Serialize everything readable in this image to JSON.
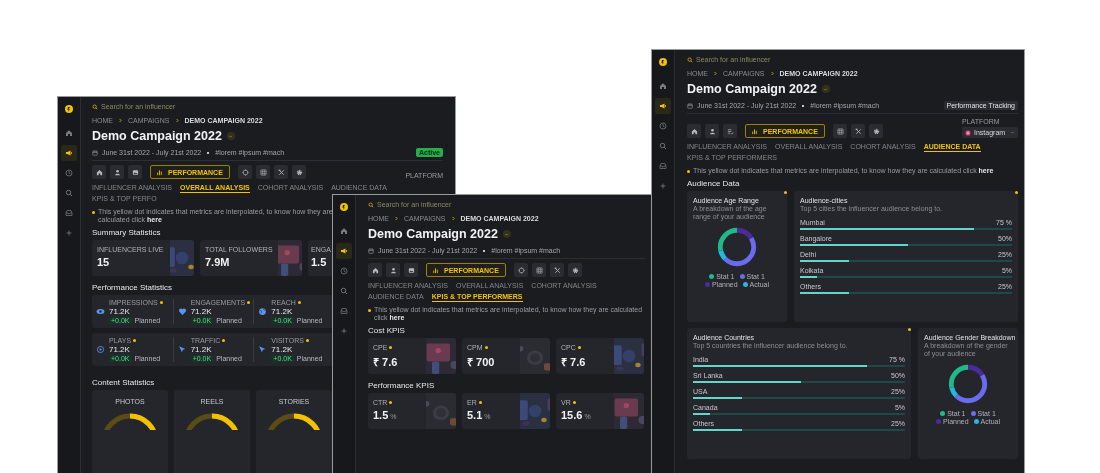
{
  "windows": [
    {
      "kind": "overall",
      "sidebar_items": [
        {
          "selected": false
        },
        {
          "selected": true
        },
        {
          "selected": false
        },
        {
          "selected": false
        },
        {
          "selected": false
        },
        {
          "selected": false
        }
      ],
      "search": {
        "placeholder": "Search for an influencer"
      },
      "breadcrumb": [
        "HOME",
        "CAMPAIGNS",
        "DEMO CAMPAIGN 2022"
      ],
      "title": "Demo Campaign 2022",
      "dates": "June 31st 2022 - July 21st 2022",
      "tags": "#lorem #ipsum #mach",
      "status": "Active",
      "view_button": "PERFORMANCE",
      "platform": {
        "label": "PLATFORM"
      },
      "tabs": [
        {
          "label": "INFLUENCER ANALYSIS",
          "selected": false
        },
        {
          "label": "OVERALL ANALYSIS",
          "selected": true
        },
        {
          "label": "COHORT ANALYSIS",
          "selected": false
        },
        {
          "label": "AUDIENCE DATA",
          "selected": false
        },
        {
          "label": "KPIS & TOP PERFO",
          "selected": false
        }
      ],
      "note": {
        "text": "This yellow dot indicates that metrics are interpolated, to know how they are calculated click",
        "link": "here"
      },
      "sections": [
        {
          "kind": "stat_cards",
          "title": "Summary Statistics",
          "cards": [
            {
              "label": "INFLUENCERS LIVE",
              "value": "15"
            },
            {
              "label": "TOTAL FOLLOWERS",
              "value": "7.9M"
            },
            {
              "label": "ENGA",
              "value": "1.5"
            }
          ]
        },
        {
          "kind": "metric_panels",
          "title": "Performance Statistics",
          "rows": [
            [
              {
                "label": "IMPRESSIONS",
                "dot": true,
                "value": "71.2K",
                "change": "+0.0K",
                "note": "Planned"
              },
              {
                "label": "ENGAGEMENTS",
                "dot": true,
                "value": "71.2K",
                "change": "+0.0K",
                "note": "Planned"
              },
              {
                "label": "REACH",
                "dot": true,
                "value": "71.2K",
                "change": "+0.0K",
                "note": "Planned"
              }
            ],
            [
              {
                "label": "PLAYS",
                "dot": true,
                "value": "71.2K",
                "change": "+0.0K",
                "note": "Planned"
              },
              {
                "label": "TRAFFIC",
                "dot": true,
                "value": "71.2K",
                "change": "+0.0K",
                "note": "Planned"
              },
              {
                "label": "VISITORS",
                "dot": true,
                "value": "71.2K",
                "change": "+0.0K",
                "note": "Planned"
              }
            ]
          ]
        },
        {
          "kind": "gauges",
          "title": "Content Statistics",
          "cards": [
            {
              "label": "PHOTOS"
            },
            {
              "label": "REELS"
            },
            {
              "label": "STORIES"
            }
          ]
        }
      ]
    },
    {
      "kind": "kpis",
      "sidebar_items": [
        {
          "selected": false
        },
        {
          "selected": true
        },
        {
          "selected": false
        },
        {
          "selected": false
        },
        {
          "selected": false
        },
        {
          "selected": false
        }
      ],
      "search": {
        "placeholder": "Search for an influencer"
      },
      "breadcrumb": [
        "HOME",
        "CAMPAIGNS",
        "DEMO CAMPAIGN 2022"
      ],
      "title": "Demo Campaign 2022",
      "dates": "June 31st 2022 - July 21st 2022",
      "tags": "#lorem #ipsum #mach",
      "view_button": "PERFORMANCE",
      "tabs": [
        {
          "label": "INFLUENCER ANALYSIS",
          "selected": false
        },
        {
          "label": "OVERALL ANALYSIS",
          "selected": false
        },
        {
          "label": "COHORT ANALYSIS",
          "selected": false
        },
        {
          "label": "AUDIENCE DATA",
          "selected": false
        },
        {
          "label": "KPIS & TOP PERFORMERS",
          "selected": true
        }
      ],
      "note": {
        "text": "This yellow dot indicates that metrics are interpolated, to know how they are calculated click",
        "link": "here"
      },
      "sections": [
        {
          "kind": "kpi_cards",
          "title": "Cost KPIS",
          "cards": [
            {
              "label": "CPE",
              "dot": true,
              "value": "₹ 7.6"
            },
            {
              "label": "CPM",
              "dot": true,
              "value": "₹ 700"
            },
            {
              "label": "CPC",
              "dot": true,
              "value": "₹ 7.6"
            }
          ]
        },
        {
          "kind": "kpi_cards",
          "title": "Performance KPIS",
          "cards": [
            {
              "label": "CTR",
              "dot": true,
              "value": "1.5",
              "unit": "%"
            },
            {
              "label": "ER",
              "dot": true,
              "value": "5.1",
              "unit": "%"
            },
            {
              "label": "VR",
              "dot": true,
              "value": "15.6",
              "unit": "%"
            }
          ]
        }
      ]
    },
    {
      "kind": "audience",
      "sidebar_items": [
        {
          "selected": false
        },
        {
          "selected": true
        },
        {
          "selected": false
        },
        {
          "selected": false
        },
        {
          "selected": false
        },
        {
          "selected": false
        }
      ],
      "search": {
        "placeholder": "Search for an influencer"
      },
      "breadcrumb": [
        "HOME",
        "CAMPAIGNS",
        "DEMO CAMPAIGN 2022"
      ],
      "title": "Demo Campaign 2022",
      "dates": "June 31st 2022 - July 21st 2022",
      "tags": "#lorem #ipsum #mach",
      "tracking_button": "Performance Tracking",
      "view_button": "PERFORMANCE",
      "platform": {
        "label": "PLATFORM",
        "value": "Instagram"
      },
      "tabs": [
        {
          "label": "INFLUENCER ANALYSIS",
          "selected": false
        },
        {
          "label": "OVERALL ANALYSIS",
          "selected": false
        },
        {
          "label": "COHORT ANALYSIS",
          "selected": false
        },
        {
          "label": "AUDIENCE DATA",
          "selected": true
        },
        {
          "label": "KPIS & TOP PERFORMERS",
          "selected": false
        }
      ],
      "note": {
        "text": "This yellow dot indicates that metrics are interpolated, to know how they are calculated click",
        "link": "here"
      },
      "sections": [
        {
          "kind": "audience",
          "title": "Audience Data",
          "cards": [
            {
              "kind": "donut",
              "title": "Audience Age Range",
              "subtitle": "A breakdown of the age range of your audience",
              "dot": true,
              "legend": [
                {
                  "label": "Stat 1",
                  "color": "#1fb98a"
                },
                {
                  "label": "Stat 1",
                  "color": "#6a6cf0"
                },
                {
                  "label": "Planned",
                  "color": "#4b2a9c"
                },
                {
                  "label": "Actual",
                  "color": "#27b6e0"
                }
              ]
            },
            {
              "kind": "bars",
              "title": "Audience-cities",
              "subtitle": "Top 5 cities the influencer audience belong to.",
              "dot": true,
              "rows": [
                {
                  "name": "Mumbai",
                  "reading": "75 %",
                  "level": 0.82
                },
                {
                  "name": "Bangalore",
                  "reading": "50%",
                  "level": 0.51
                },
                {
                  "name": "Delhi",
                  "reading": "25%",
                  "level": 0.23
                },
                {
                  "name": "Kolkata",
                  "reading": "5%",
                  "level": 0.08
                },
                {
                  "name": "Others",
                  "reading": "25%",
                  "level": 0.23
                }
              ]
            },
            {
              "kind": "bars",
              "title": "Audience Countries",
              "subtitle": "Top 5 countries the influencer audience belong to.",
              "dot": true,
              "rows": [
                {
                  "name": "India",
                  "reading": "75 %",
                  "level": 0.82
                },
                {
                  "name": "Sri Lanka",
                  "reading": "50%",
                  "level": 0.51
                },
                {
                  "name": "USA",
                  "reading": "25%",
                  "level": 0.23
                },
                {
                  "name": "Canada",
                  "reading": "5%",
                  "level": 0.08
                },
                {
                  "name": "Others",
                  "reading": "25%",
                  "level": 0.23
                }
              ]
            },
            {
              "kind": "donut",
              "title": "Audience Gender Breakdown",
              "subtitle": "A breakdown of the gender of your audience",
              "dot": false,
              "legend": [
                {
                  "label": "Stat 1",
                  "color": "#1fb98a"
                },
                {
                  "label": "Stat 1",
                  "color": "#6a6cf0"
                },
                {
                  "label": "Planned",
                  "color": "#4b2a9c"
                },
                {
                  "label": "Actual",
                  "color": "#27b6e0"
                }
              ]
            }
          ]
        }
      ]
    }
  ]
}
